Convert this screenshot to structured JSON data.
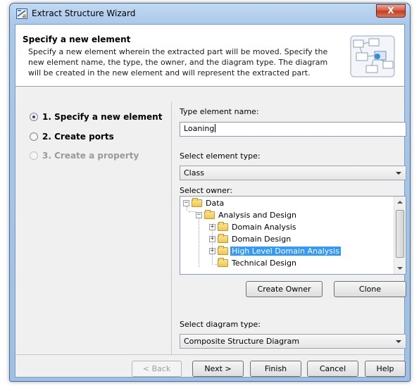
{
  "window": {
    "title": "Extract Structure Wizard",
    "close_label": "X"
  },
  "header": {
    "title": "Specify a new element",
    "description": "Specify a new element wherein the extracted part will be moved. Specify the new element name, the type, the owner, and the diagram type. The diagram will be created in the new element and will represent the extracted part."
  },
  "steps": [
    {
      "label": "1. Specify a new element",
      "state": "selected"
    },
    {
      "label": "2. Create ports",
      "state": "enabled"
    },
    {
      "label": "3. Create a property",
      "state": "disabled"
    }
  ],
  "form": {
    "name_label": "Type element name:",
    "name_value": "Loaning",
    "type_label": "Select element type:",
    "type_value": "Class",
    "owner_label": "Select owner:",
    "diagram_label": "Select diagram type:",
    "diagram_value": "Composite Structure Diagram"
  },
  "owner_tree": [
    {
      "label": "Data",
      "level": 0,
      "expander": "minus",
      "icon": "package-icon"
    },
    {
      "label": "Analysis and Design",
      "level": 1,
      "expander": "minus",
      "icon": "folder-icon"
    },
    {
      "label": "Domain Analysis",
      "level": 2,
      "expander": "plus",
      "icon": "folder-icon"
    },
    {
      "label": "Domain Design",
      "level": 2,
      "expander": "plus",
      "icon": "folder-icon"
    },
    {
      "label": "High Level Domain Analysis",
      "level": 2,
      "expander": "plus",
      "icon": "folder-icon",
      "selected": true
    },
    {
      "label": "Technical Design",
      "level": 2,
      "expander": "none",
      "icon": "folder-icon"
    }
  ],
  "owner_buttons": {
    "create_owner": "Create Owner",
    "clone": "Clone"
  },
  "footer_buttons": {
    "back": "< Back",
    "next": "Next >",
    "finish": "Finish",
    "cancel": "Cancel",
    "help": "Help"
  },
  "colors": {
    "selection": "#3399ff",
    "title_bar": "#a9c8ea",
    "close_button": "#c23b20"
  }
}
